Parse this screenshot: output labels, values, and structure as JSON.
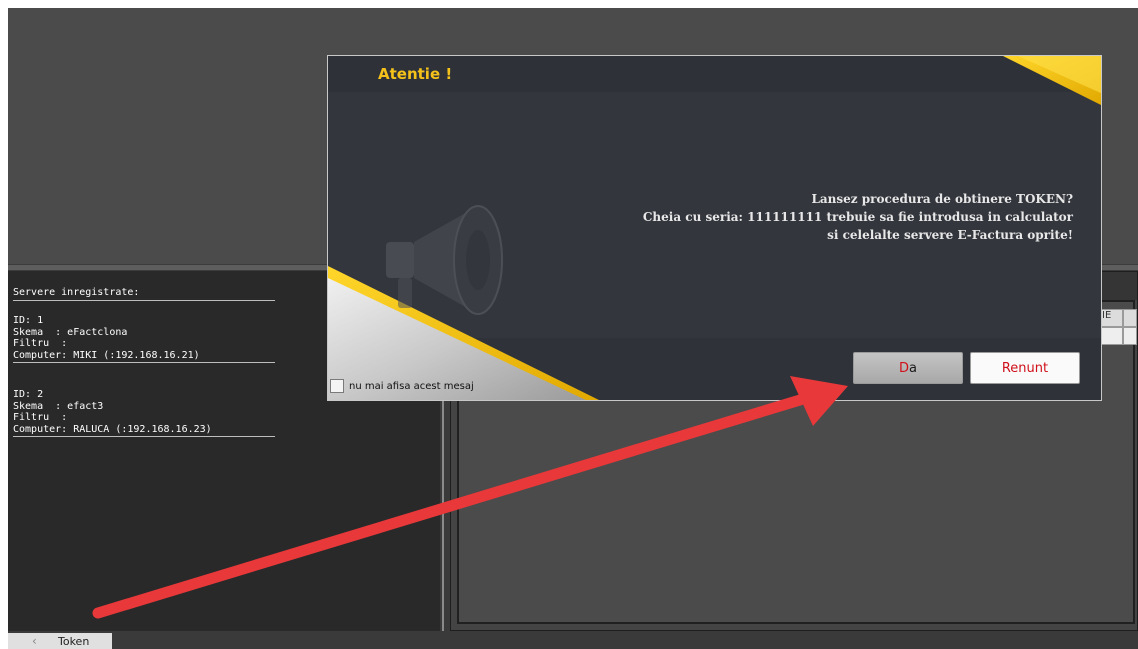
{
  "servers": {
    "title": "Servere inregistrate:",
    "entries": [
      {
        "id_line": "ID: 1",
        "schema_line": "Skema  : eFactclona",
        "filter_line": "Filtru  :",
        "computer_line": "Computer: MIKI (:192.168.16.21)"
      },
      {
        "id_line": "ID: 2",
        "schema_line": "Skema  : efact3",
        "filter_line": "Filtru  :",
        "computer_line": "Computer: RALUCA (:192.168.16.23)"
      }
    ]
  },
  "grid": {
    "header_fragment": "IE"
  },
  "bottom_bar": {
    "tab_label": "Token",
    "tab_icon": "chevron-left-icon"
  },
  "dialog": {
    "title": "Atentie !",
    "message_lines": [
      "Lansez procedura de obtinere TOKEN?",
      "Cheia cu seria: 111111111 trebuie sa fie introdusa in calculator",
      "si celelalte servere E-Factura oprite!"
    ],
    "yes_button": {
      "first": "D",
      "rest": "a"
    },
    "cancel_button": "Renunt",
    "checkbox_label": "nu mai afisa acest mesaj",
    "checkbox_checked": false,
    "illustration_icon": "megaphone-icon",
    "accent_color": "#f4c21a"
  },
  "annotation": {
    "arrow_icon": "red-arrow-icon",
    "arrow_color": "#e8383a"
  }
}
